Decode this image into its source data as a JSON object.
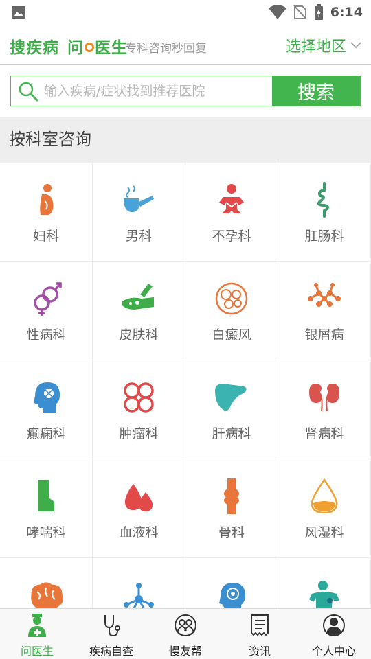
{
  "status_bar": {
    "time": "6:14"
  },
  "header": {
    "brand_part1": "搜疾病",
    "brand_part2_prefix": "问",
    "brand_part2_suffix": "医生",
    "slogan": "专科咨询秒回复",
    "region_label": "选择地区"
  },
  "search": {
    "placeholder": "输入疾病/症状找到推荐医院",
    "button_label": "搜索"
  },
  "section": {
    "title": "按科室咨询"
  },
  "departments": [
    {
      "label": "妇科",
      "icon": "pregnant-woman-icon",
      "color": "#e8763a"
    },
    {
      "label": "男科",
      "icon": "pipe-icon",
      "color": "#4aa3d8"
    },
    {
      "label": "不孕科",
      "icon": "baby-icon",
      "color": "#e24a4a"
    },
    {
      "label": "肛肠科",
      "icon": "intestine-icon",
      "color": "#3a9e6a"
    },
    {
      "label": "性病科",
      "icon": "gender-symbol-icon",
      "color": "#a34fa8"
    },
    {
      "label": "皮肤科",
      "icon": "hand-cream-icon",
      "color": "#3fae4a"
    },
    {
      "label": "白癜风",
      "icon": "cells-icon",
      "color": "#e8763a"
    },
    {
      "label": "银屑病",
      "icon": "molecule-icon",
      "color": "#e8763a"
    },
    {
      "label": "癫痫科",
      "icon": "brain-head-icon",
      "color": "#3b8fd1"
    },
    {
      "label": "肿瘤科",
      "icon": "tumor-icon",
      "color": "#e24a4a"
    },
    {
      "label": "肝病科",
      "icon": "liver-icon",
      "color": "#3bb3b0"
    },
    {
      "label": "肾病科",
      "icon": "kidney-icon",
      "color": "#d9534f"
    },
    {
      "label": "哮喘科",
      "icon": "inhaler-icon",
      "color": "#3fae4a"
    },
    {
      "label": "血液科",
      "icon": "blood-drop-icon",
      "color": "#e24a4a"
    },
    {
      "label": "骨科",
      "icon": "knee-joint-icon",
      "color": "#e8763a"
    },
    {
      "label": "风湿科",
      "icon": "drop-icon",
      "color": "#f0a030"
    },
    {
      "label": "",
      "icon": "brain-icon",
      "color": "#e8763a"
    },
    {
      "label": "",
      "icon": "network-icon",
      "color": "#3b8fd1"
    },
    {
      "label": "",
      "icon": "head-mind-icon",
      "color": "#3b8fd1"
    },
    {
      "label": "",
      "icon": "person-icon",
      "color": "#2aa89a"
    }
  ],
  "bottom_nav": [
    {
      "label": "问医生",
      "icon": "doctor-icon",
      "active": true
    },
    {
      "label": "疾病自查",
      "icon": "stethoscope-icon",
      "active": false
    },
    {
      "label": "慢友帮",
      "icon": "group-icon",
      "active": false
    },
    {
      "label": "资讯",
      "icon": "news-icon",
      "active": false
    },
    {
      "label": "个人中心",
      "icon": "user-icon",
      "active": false
    }
  ],
  "colors": {
    "accent": "#3fae4a",
    "button": "#43b54e"
  }
}
